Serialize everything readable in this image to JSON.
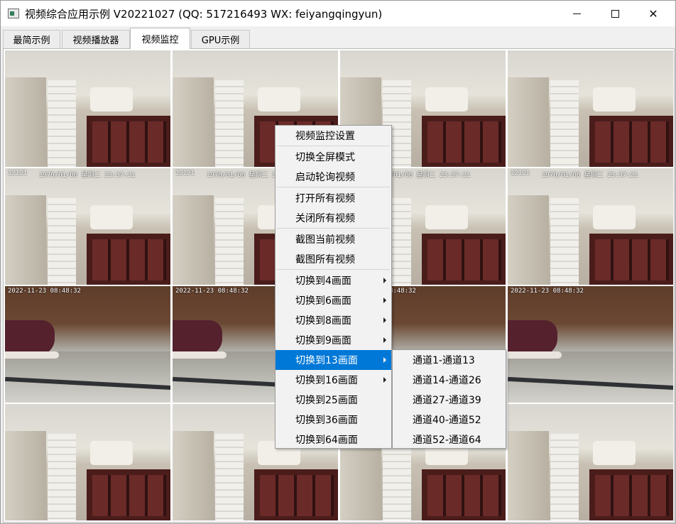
{
  "window": {
    "title": "视频综合应用示例 V20221027 (QQ: 517216493 WX: feiyangqingyun)",
    "controls": [
      "minimize",
      "maximize",
      "close"
    ]
  },
  "tabs": [
    {
      "label": "最简示例",
      "active": false
    },
    {
      "label": "视频播放器",
      "active": false
    },
    {
      "label": "视频监控",
      "active": true
    },
    {
      "label": "GPU示例",
      "active": false
    }
  ],
  "video_grid": {
    "rows": 4,
    "columns": 4,
    "osd_texts": [
      "12121",
      "1970/01/06 星期二 23:37:21",
      "2022-11-23 08:48:32"
    ]
  },
  "context_menu": {
    "items": [
      {
        "label": "视频监控设置",
        "submenu": false
      },
      {
        "label": "切换全屏模式",
        "submenu": false
      },
      {
        "label": "启动轮询视频",
        "submenu": false
      },
      {
        "label": "打开所有视频",
        "submenu": false
      },
      {
        "label": "关闭所有视频",
        "submenu": false
      },
      {
        "label": "截图当前视频",
        "submenu": false
      },
      {
        "label": "截图所有视频",
        "submenu": false
      },
      {
        "label": "切换到4画面",
        "submenu": true
      },
      {
        "label": "切换到6画面",
        "submenu": true
      },
      {
        "label": "切换到8画面",
        "submenu": true
      },
      {
        "label": "切换到9画面",
        "submenu": true
      },
      {
        "label": "切换到13画面",
        "submenu": true,
        "selected": true
      },
      {
        "label": "切换到16画面",
        "submenu": true
      },
      {
        "label": "切换到25画面",
        "submenu": false
      },
      {
        "label": "切换到36画面",
        "submenu": false
      },
      {
        "label": "切换到64画面",
        "submenu": false
      }
    ],
    "submenu_items": [
      "通道1-通道13",
      "通道14-通道26",
      "通道27-通道39",
      "通道40-通道52",
      "通道52-通道64"
    ],
    "highlight_color": "#0078d7"
  }
}
